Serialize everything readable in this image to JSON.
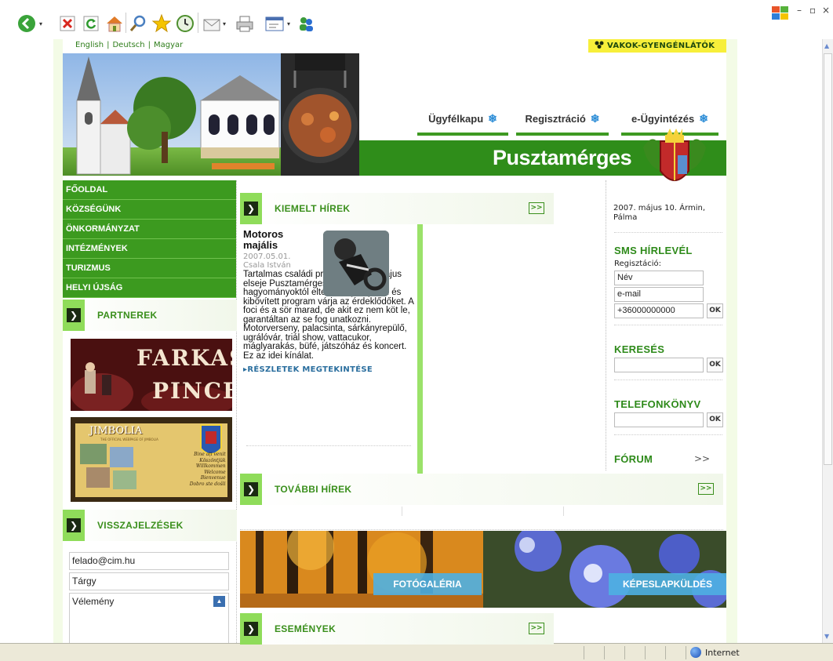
{
  "browser": {
    "toolbar_icons": [
      {
        "name": "back-icon"
      },
      {
        "name": "stop-icon"
      },
      {
        "name": "refresh-icon"
      },
      {
        "name": "home-icon"
      },
      {
        "name": "search-icon"
      },
      {
        "name": "favorites-icon"
      },
      {
        "name": "history-icon"
      },
      {
        "name": "mail-icon"
      },
      {
        "name": "print-icon"
      },
      {
        "name": "edit-icon"
      },
      {
        "name": "messenger-icon"
      }
    ],
    "status_zone": "Internet"
  },
  "site": {
    "languages": [
      "English",
      "Deutsch",
      "Magyar"
    ],
    "accessibility_label": "VAKOK-GYENGÉNLÁTÓK",
    "header_buttons": [
      "Ügyfélkapu",
      "Regisztráció",
      "e-Ügyintézés"
    ],
    "town_name": "Pusztamérges",
    "nav": [
      "FŐOLDAL",
      "KÖZSÉGÜNK",
      "ÖNKORMÁNYZAT",
      "INTÉZMÉNYEK",
      "TURIZMUS",
      "HELYI ÚJSÁG"
    ],
    "partners_title": "PARTNEREK",
    "partner_banners": [
      {
        "title": "FARKAS",
        "subtitle": "PINCE"
      },
      {
        "title": "JIMBOLIA",
        "small": "THE OFFICIAL WEBPAGE OF JIMBOLIA",
        "greeting": [
          "Bine ați venit !",
          "Köszöntjük !",
          "Willkommen !",
          "Welcome !",
          "Bienvenue !",
          "Dobro ste došli !"
        ]
      }
    ],
    "feedback": {
      "title": "VISSZAJELZÉSEK",
      "email_value": "felado@cim.hu",
      "subject_value": "Tárgy",
      "opinion_value": "Vélemény"
    },
    "featured": {
      "title": "KIEMELT HÍREK",
      "more_label": ">>",
      "article": {
        "title": "Motoros majális",
        "date": "2007.05.01.",
        "author": "Csala István",
        "text": "Tartalmas családi program lesz a május elseje Pusztamérgesen. A hagyományoktól eltérően új helyszín és kibővített program várja az érdeklődőket. A foci és a sör marad, de akit ez nem köt le, garantáltan az se fog unatkozni. Motorverseny, palacsinta, sárkányrepülő, ugrálóvár, triál show, vattacukor, máglyarakás, büfé, játszóház és koncert. Ez az idei kínálat.",
        "more": "RÉSZLETEK MEGTEKINTÉSE"
      }
    },
    "more_news": {
      "title": "TOVÁBBI HÍREK",
      "more_label": ">>"
    },
    "events": {
      "title": "ESEMÉNYEK",
      "more_label": ">>"
    },
    "photo_links": [
      "FOTÓGALÉRIA",
      "KÉPESLAPKÜLDÉS"
    ],
    "right": {
      "date_line": "2007. május 10. Ármin, Pálma",
      "sms_title": "SMS HÍRLEVÉL",
      "sms_sub": "Regisztáció:",
      "name_value": "Név",
      "email_value": "e-mail",
      "phone_value": "+36000000000",
      "ok": "OK",
      "search_title": "KERESÉS",
      "phonebook_title": "TELEFONKÖNYV",
      "forum_title": "FÓRUM",
      "forum_more": ">>"
    }
  },
  "colors": {
    "brand_green": "#3c9a1f",
    "accent_light_green": "#9be26a",
    "access_yellow": "#f7ef3a",
    "photo_label_blue": "#4eb0e2"
  }
}
